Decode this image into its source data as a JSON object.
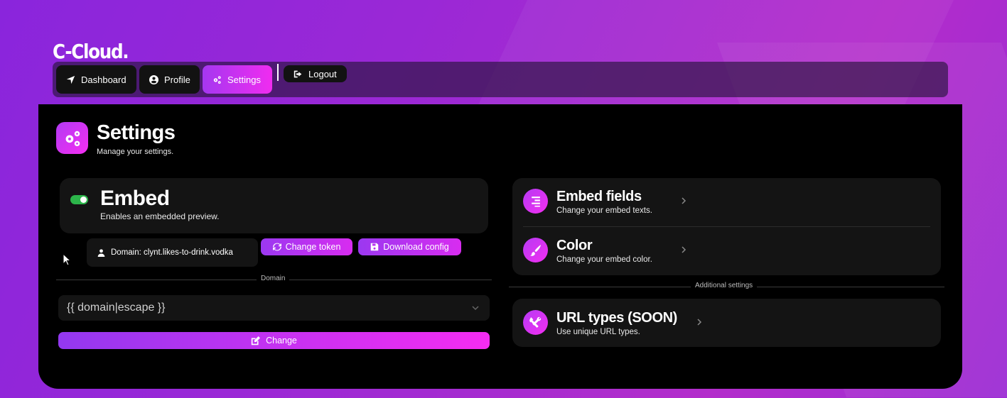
{
  "brand": "C-Cloud.",
  "nav": {
    "items": [
      {
        "label": "Dashboard",
        "icon": "location-arrow-icon"
      },
      {
        "label": "Profile",
        "icon": "user-circle-icon"
      },
      {
        "label": "Settings",
        "icon": "cogs-icon",
        "active": true
      }
    ],
    "logout_label": "Logout"
  },
  "header": {
    "title": "Settings",
    "subtitle": "Manage your settings."
  },
  "embed": {
    "title": "Embed",
    "subtitle": "Enables an embedded preview.",
    "enabled": true,
    "domain_text": "Domain: clynt.likes-to-drink.vodka",
    "change_token_label": "Change token",
    "download_config_label": "Download config",
    "domain_divider_label": "Domain",
    "domain_select_value": "{{ domain|escape }}",
    "change_label": "Change"
  },
  "right": {
    "embed_fields_title": "Embed fields",
    "embed_fields_sub": "Change your embed texts.",
    "color_title": "Color",
    "color_sub": "Change your embed color.",
    "additional_label": "Additional settings",
    "url_types_title": "URL types (SOON)",
    "url_types_sub": "Use unique URL types."
  },
  "colors": {
    "accent_start": "#9b38f0",
    "accent_end": "#f52cf2",
    "toggle_on": "#2cb54a",
    "card_bg": "#141414"
  }
}
